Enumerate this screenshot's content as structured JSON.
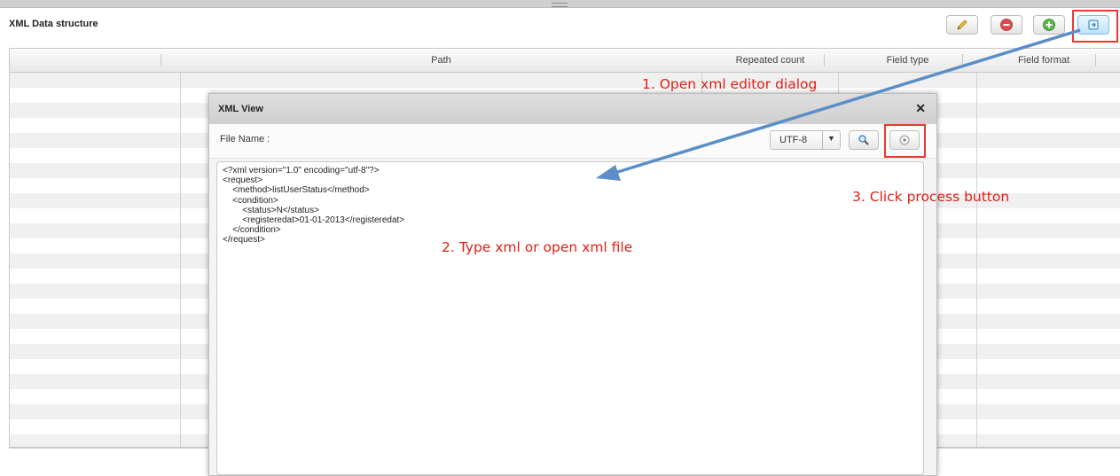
{
  "panel": {
    "title": "XML Data structure"
  },
  "toolbar": {
    "buttons": [
      {
        "name": "edit",
        "icon": "pencil-icon"
      },
      {
        "name": "delete",
        "icon": "minus-circle-icon"
      },
      {
        "name": "add",
        "icon": "plus-circle-icon"
      },
      {
        "name": "open-xml-editor",
        "icon": "xml-import-icon",
        "active": true
      }
    ]
  },
  "table": {
    "columns": [
      "",
      "Path",
      "Repeated count",
      "Field type",
      "Field format"
    ]
  },
  "dialog": {
    "title": "XML View",
    "close_glyph": "✕",
    "file_label": "File Name :",
    "encoding": {
      "selected": "UTF-8"
    },
    "editor_text": "<?xml version=\"1.0\" encoding=\"utf-8\"?>\n<request>\n    <method>listUserStatus</method>\n    <condition>\n        <status>N</status>\n        <registeredat>01-01-2013</registeredat>\n    </condition>\n</request>"
  },
  "annotations": {
    "step1": "1. Open xml editor dialog",
    "step2": "2. Type xml or open xml file",
    "step3": "3. Click process button"
  },
  "colors": {
    "annotation": "#e21d14",
    "arrow": "#5b8ec7",
    "highlight_box": "#e8392f"
  }
}
